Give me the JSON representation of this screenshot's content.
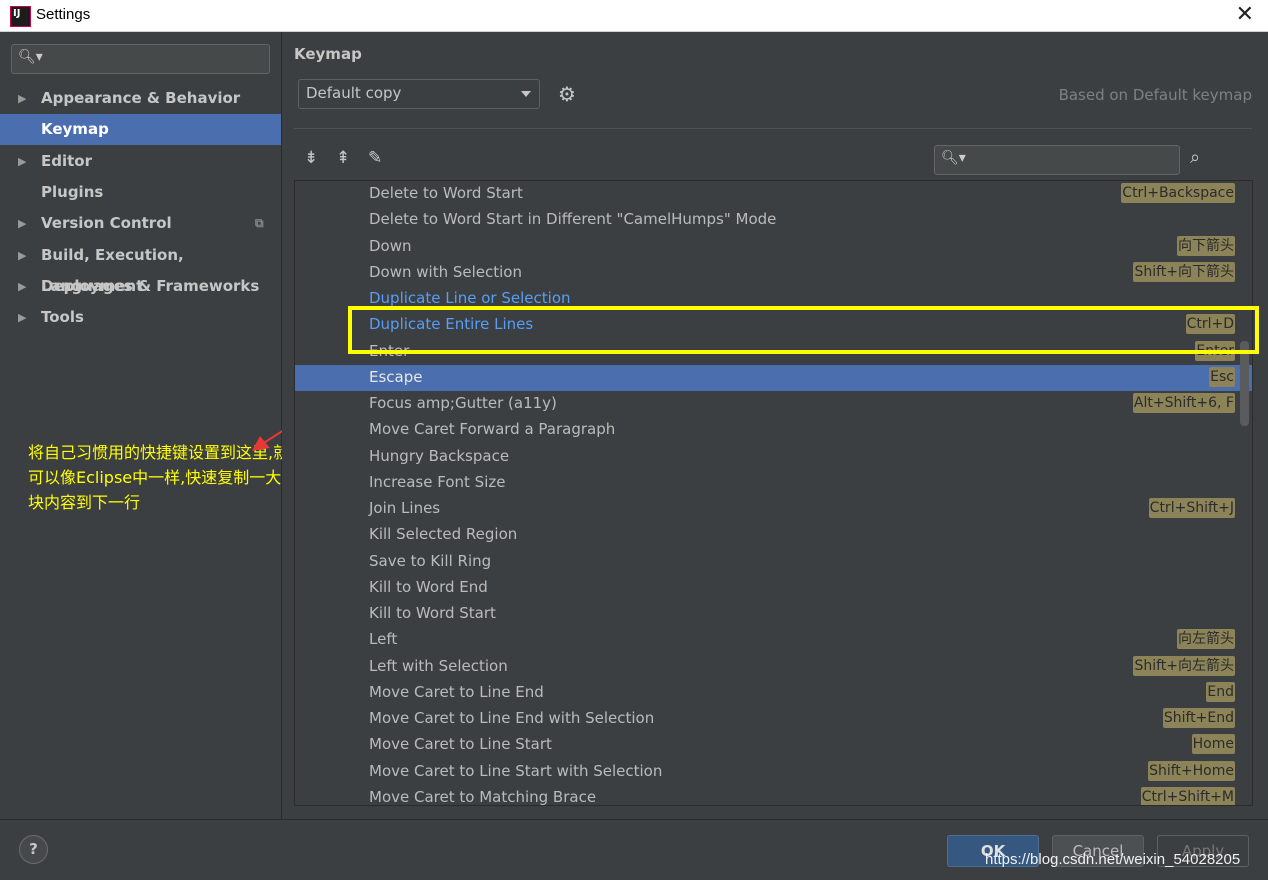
{
  "window": {
    "title": "Settings"
  },
  "sidebar": {
    "search_placeholder": "",
    "items": [
      {
        "label": "Appearance & Behavior",
        "expandable": true
      },
      {
        "label": "Keymap",
        "expandable": false,
        "selected": true
      },
      {
        "label": "Editor",
        "expandable": true
      },
      {
        "label": "Plugins",
        "expandable": false
      },
      {
        "label": "Version Control",
        "expandable": true
      },
      {
        "label": "Build, Execution, Deployment",
        "expandable": true
      },
      {
        "label": "Languages & Frameworks",
        "expandable": true
      },
      {
        "label": "Tools",
        "expandable": true
      }
    ],
    "annotation": "将自己习惯用的快捷键设置到这里,就可以像Eclipse中一样,快速复制一大块内容到下一行"
  },
  "keymap": {
    "title": "Keymap",
    "scheme": "Default copy",
    "based_on": "Based on Default keymap",
    "actions": [
      {
        "name": "Delete to Word Start",
        "shortcut": "Ctrl+Backspace"
      },
      {
        "name": "Delete to Word Start in Different \"CamelHumps\" Mode",
        "shortcut": ""
      },
      {
        "name": "Down",
        "shortcut": "向下箭头"
      },
      {
        "name": "Down with Selection",
        "shortcut": "Shift+向下箭头"
      },
      {
        "name": "Duplicate Line or Selection",
        "shortcut": "",
        "modified": true
      },
      {
        "name": "Duplicate Entire Lines",
        "shortcut": "Ctrl+D",
        "modified": true
      },
      {
        "name": "Enter",
        "shortcut": "Enter"
      },
      {
        "name": "Escape",
        "shortcut": "Esc",
        "selected": true
      },
      {
        "name": "Focus amp;Gutter (a11y)",
        "shortcut": "Alt+Shift+6, F"
      },
      {
        "name": "Move Caret Forward a Paragraph",
        "shortcut": ""
      },
      {
        "name": "Hungry Backspace",
        "shortcut": ""
      },
      {
        "name": "Increase Font Size",
        "shortcut": ""
      },
      {
        "name": "Join Lines",
        "shortcut": "Ctrl+Shift+J"
      },
      {
        "name": "Kill Selected Region",
        "shortcut": ""
      },
      {
        "name": "Save to Kill Ring",
        "shortcut": ""
      },
      {
        "name": "Kill to Word End",
        "shortcut": ""
      },
      {
        "name": "Kill to Word Start",
        "shortcut": ""
      },
      {
        "name": "Left",
        "shortcut": "向左箭头"
      },
      {
        "name": "Left with Selection",
        "shortcut": "Shift+向左箭头"
      },
      {
        "name": "Move Caret to Line End",
        "shortcut": "End"
      },
      {
        "name": "Move Caret to Line End with Selection",
        "shortcut": "Shift+End"
      },
      {
        "name": "Move Caret to Line Start",
        "shortcut": "Home"
      },
      {
        "name": "Move Caret to Line Start with Selection",
        "shortcut": "Shift+Home"
      },
      {
        "name": "Move Caret to Matching Brace",
        "shortcut": "Ctrl+Shift+M"
      }
    ]
  },
  "buttons": {
    "ok": "OK",
    "cancel": "Cancel",
    "apply": "Apply",
    "help": "?"
  },
  "watermark": "https://blog.csdn.net/weixin_54028205",
  "colors": {
    "selection": "#4b6eaf",
    "modified_text": "#589df6",
    "shortcut_bg": "#8c8458",
    "annotation": "#ffff00",
    "arrow": "#e53935"
  }
}
